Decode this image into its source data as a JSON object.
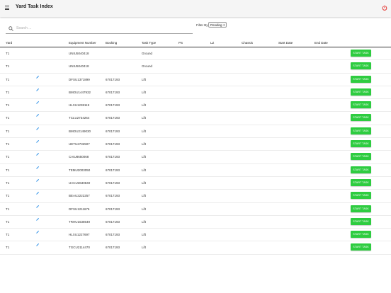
{
  "app_bar": {
    "title": "Yard Task Index",
    "menu_icon": "hamburger-menu-icon",
    "power_icon": "power-icon",
    "power_color": "#e53935"
  },
  "search": {
    "placeholder": "Search ...",
    "value": "",
    "icon": "search-icon"
  },
  "filter": {
    "label": "Filter By:",
    "selected": "Pending"
  },
  "table": {
    "headers": {
      "yard": "Yard",
      "equipment_number": "Equipment Number",
      "booking": "Booking",
      "task_type": "Task Type",
      "ps": "PS",
      "lz": "LZ",
      "chassis": "Chassis",
      "start_date": "Start Date",
      "end_date": "End Date"
    },
    "action_label": "START TASK",
    "action_color": "#2ecc40",
    "rows": [
      {
        "yard": "T1",
        "equipment": "UNIU5040418",
        "booking": "",
        "task_type": "Ground",
        "editable": false
      },
      {
        "yard": "T1",
        "equipment": "UNIU5040418",
        "booking": "",
        "task_type": "Ground",
        "editable": false
      },
      {
        "yard": "T1",
        "equipment": "DFSU1371899",
        "booking": "67017193",
        "task_type": "Lift",
        "editable": true
      },
      {
        "yard": "T1",
        "equipment": "BMOU1447932",
        "booking": "67017193",
        "task_type": "Lift",
        "editable": true
      },
      {
        "yard": "T1",
        "equipment": "HLXU1238119",
        "booking": "67017193",
        "task_type": "Lift",
        "editable": true
      },
      {
        "yard": "T1",
        "equipment": "TCLU2734264",
        "booking": "67017193",
        "task_type": "Lift",
        "editable": true
      },
      {
        "yard": "T1",
        "equipment": "BMOU2149030",
        "booking": "67017193",
        "task_type": "Lift",
        "editable": true
      },
      {
        "yard": "T1",
        "equipment": "UETU2732507",
        "booking": "67017193",
        "task_type": "Lift",
        "editable": true
      },
      {
        "yard": "T1",
        "equipment": "CAIU8650068",
        "booking": "67017193",
        "task_type": "Lift",
        "editable": true
      },
      {
        "yard": "T1",
        "equipment": "TEMU2003050",
        "booking": "67017193",
        "task_type": "Lift",
        "editable": true
      },
      {
        "yard": "T1",
        "equipment": "UACU3630840",
        "booking": "67017193",
        "task_type": "Lift",
        "editable": true
      },
      {
        "yard": "T1",
        "equipment": "BEAU2222257",
        "booking": "67017193",
        "task_type": "Lift",
        "editable": true
      },
      {
        "yard": "T1",
        "equipment": "DFSU1211676",
        "booking": "67017193",
        "task_type": "Lift",
        "editable": true
      },
      {
        "yard": "T1",
        "equipment": "TRHU1638649",
        "booking": "67017193",
        "task_type": "Lift",
        "editable": true
      },
      {
        "yard": "T1",
        "equipment": "HLXU1227697",
        "booking": "67017193",
        "task_type": "Lift",
        "editable": true
      },
      {
        "yard": "T1",
        "equipment": "TGCU2114470",
        "booking": "67017193",
        "task_type": "Lift",
        "editable": true
      }
    ]
  }
}
